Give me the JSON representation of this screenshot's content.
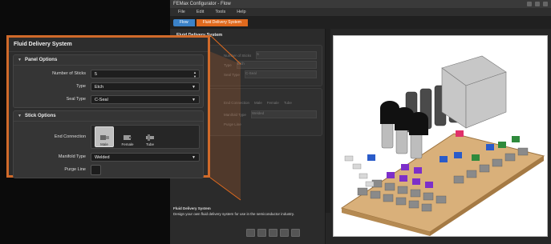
{
  "app": {
    "title": "FEMax Configurator - Flow",
    "menu": [
      "File",
      "Edit",
      "Tools",
      "Help"
    ]
  },
  "breadcrumb": {
    "home": "Flow",
    "current": "Fluid Delivery System"
  },
  "left_panel": {
    "title": "Fluid Delivery System",
    "description_title": "Fluid Delivery System",
    "description": "Design your own fluid delivery system for use in the semiconductor industry."
  },
  "zoom_panel": {
    "title": "Fluid Delivery System",
    "panel_options": {
      "header": "Panel Options",
      "number_of_sticks_label": "Number of Sticks",
      "number_of_sticks_value": "5",
      "type_label": "Type",
      "type_value": "Etch",
      "seal_type_label": "Seal Type",
      "seal_type_value": "C-Seal"
    },
    "stick_options": {
      "header": "Stick Options",
      "end_connection_label": "End Connection",
      "connections": [
        "Male",
        "Female",
        "Tube"
      ],
      "selected_connection": "Male",
      "manifold_type_label": "Manifold Type",
      "manifold_type_value": "Welded",
      "purge_line_label": "Purge Line"
    }
  },
  "ghost_fields": {
    "sticks_label": "Number of Sticks",
    "sticks_value": "5",
    "type_label": "Type",
    "type_value": "Etch",
    "seal_label": "Seal Type",
    "seal_value": "C-Seal",
    "conn_label": "End Connection",
    "conn_opts": [
      "Male",
      "Female",
      "Tube"
    ],
    "manifold_label": "Manifold Type",
    "manifold_value": "Welded",
    "purge_label": "Purge Line"
  },
  "colors": {
    "accent_orange": "#e06a1e",
    "crumb_blue": "#3b82c8",
    "panel_bg": "#2d2d2d"
  }
}
